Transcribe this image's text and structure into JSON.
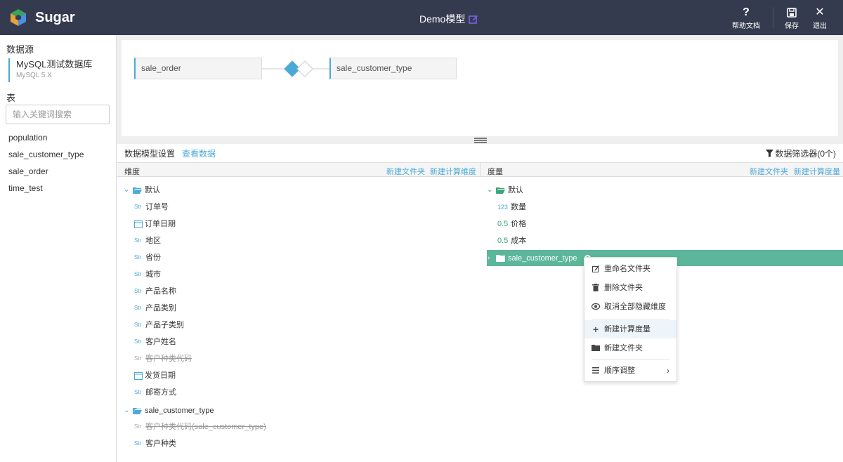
{
  "header": {
    "brand": "Sugar",
    "model_title": "Demo模型",
    "help_label": "帮助文档",
    "save_label": "保存",
    "exit_label": "退出",
    "help_glyph": "?",
    "exit_glyph": "✕"
  },
  "sidebar": {
    "datasource_heading": "数据源",
    "datasource_name": "MySQL测试数据库",
    "datasource_version": "MySQL 5.X",
    "tables_heading": "表",
    "search_placeholder": "输入关键词搜索",
    "tables": [
      "population",
      "sale_customer_type",
      "sale_order",
      "time_test"
    ]
  },
  "canvas": {
    "left_node": "sale_order",
    "right_node": "sale_customer_type"
  },
  "subbar": {
    "tab_settings": "数据模型设置",
    "tab_view_data": "查看数据",
    "filter_label": "数据筛选器(0个)"
  },
  "dimensions": {
    "title": "维度",
    "new_folder": "新建文件夹",
    "new_calc": "新建计算维度",
    "folder_default": "默认",
    "items": [
      {
        "type": "Str",
        "name": "订单号"
      },
      {
        "type": "date",
        "name": "订单日期"
      },
      {
        "type": "Str",
        "name": "地区"
      },
      {
        "type": "Str",
        "name": "省份"
      },
      {
        "type": "Str",
        "name": "城市"
      },
      {
        "type": "Str",
        "name": "产品名称"
      },
      {
        "type": "Str",
        "name": "产品类别"
      },
      {
        "type": "Str",
        "name": "产品子类别"
      },
      {
        "type": "Str",
        "name": "客户姓名"
      },
      {
        "type": "Str",
        "name": "客户种类代码",
        "hidden": true
      },
      {
        "type": "date",
        "name": "发货日期"
      },
      {
        "type": "Str",
        "name": "邮寄方式"
      }
    ],
    "folder2": "sale_customer_type",
    "folder2_items": [
      {
        "type": "Str",
        "name": "客户种类代码(sale_customer_type)",
        "hidden": true
      },
      {
        "type": "Str",
        "name": "客户种类"
      }
    ]
  },
  "measures": {
    "title": "度量",
    "new_folder": "新建文件夹",
    "new_calc": "新建计算度量",
    "folder_default": "默认",
    "items": [
      {
        "type": "123",
        "name": "数量"
      },
      {
        "type": "0.5",
        "name": "价格"
      },
      {
        "type": "0.5",
        "name": "成本"
      }
    ],
    "selected_folder": "sale_customer_type"
  },
  "context_menu": {
    "items": [
      {
        "icon": "edit-icon",
        "label": "重命名文件夹"
      },
      {
        "icon": "trash-icon",
        "label": "删除文件夹"
      },
      {
        "icon": "eye-icon",
        "label": "取消全部隐藏维度"
      },
      {
        "icon": "plus-icon",
        "label": "新建计算度量"
      },
      {
        "icon": "folder-icon",
        "label": "新建文件夹"
      },
      {
        "icon": "list-icon",
        "label": "顺序调整"
      }
    ]
  },
  "colors": {
    "topbar": "#353b4f",
    "accent": "#4ba9d8",
    "highlight": "#5bb69a"
  }
}
